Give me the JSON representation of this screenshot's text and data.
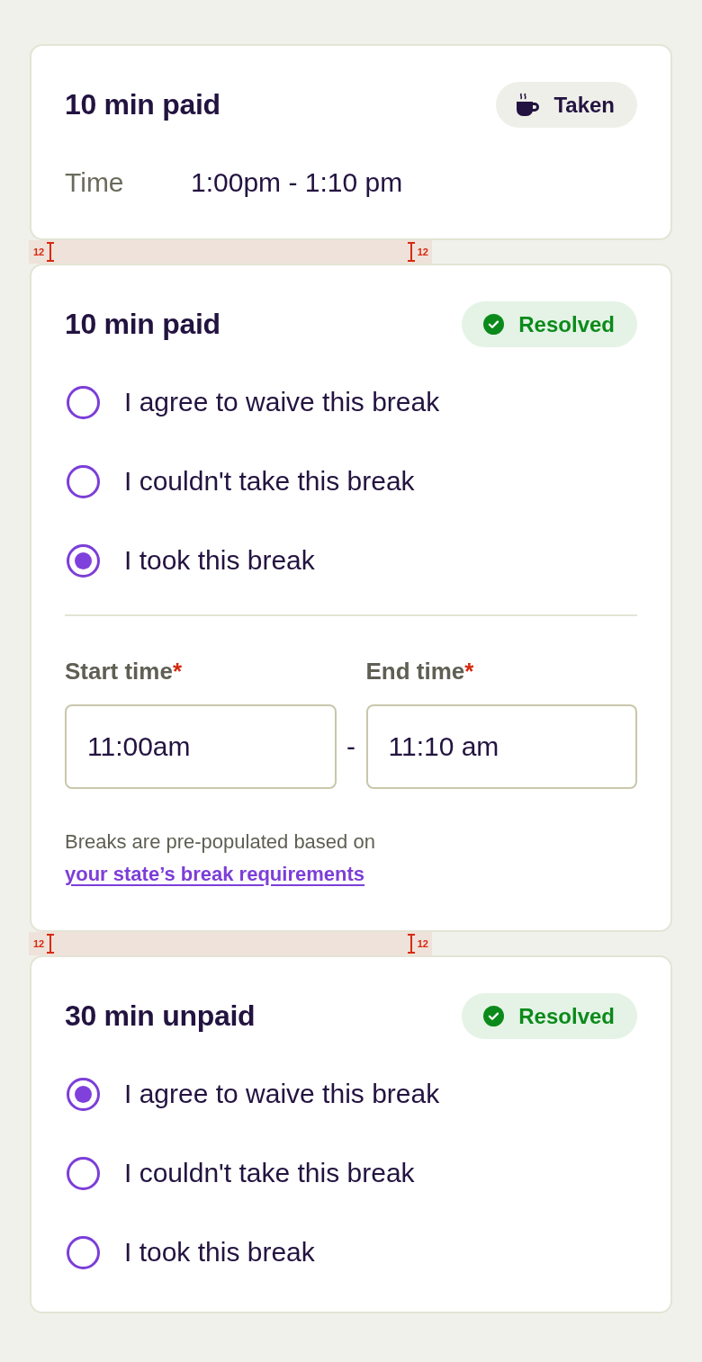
{
  "items": [
    {
      "kind": "card",
      "title": "10 min paid",
      "status": {
        "kind": "taken",
        "label": "Taken"
      },
      "time": {
        "label": "Time",
        "value": "1:00pm - 1:10 pm"
      }
    },
    {
      "kind": "spacing_annotation",
      "markers": [
        {
          "label": "12"
        },
        {
          "label": "12"
        }
      ]
    },
    {
      "kind": "card",
      "title": "10 min paid",
      "status": {
        "kind": "resolved",
        "label": "Resolved"
      },
      "options": [
        {
          "label": "I agree to waive this break",
          "selected": false
        },
        {
          "label": "I couldn't take this break",
          "selected": false
        },
        {
          "label": "I took this break",
          "selected": true
        }
      ],
      "time_fields": [
        {
          "label": "Start time",
          "required_mark": "*",
          "value": "11:00am"
        },
        {
          "label": "End time",
          "required_mark": "*",
          "value": "11:10 am"
        }
      ],
      "separator": "-",
      "note": {
        "text": "Breaks are pre-populated based on",
        "link": "your state’s break requirements"
      }
    },
    {
      "kind": "spacing_annotation",
      "markers": [
        {
          "label": "12"
        },
        {
          "label": "12"
        }
      ]
    },
    {
      "kind": "card",
      "title": "30 min unpaid",
      "status": {
        "kind": "resolved",
        "label": "Resolved"
      },
      "options": [
        {
          "label": "I agree to waive this break",
          "selected": true
        },
        {
          "label": "I couldn't take this break",
          "selected": false
        },
        {
          "label": "I took this break",
          "selected": false
        }
      ]
    }
  ]
}
